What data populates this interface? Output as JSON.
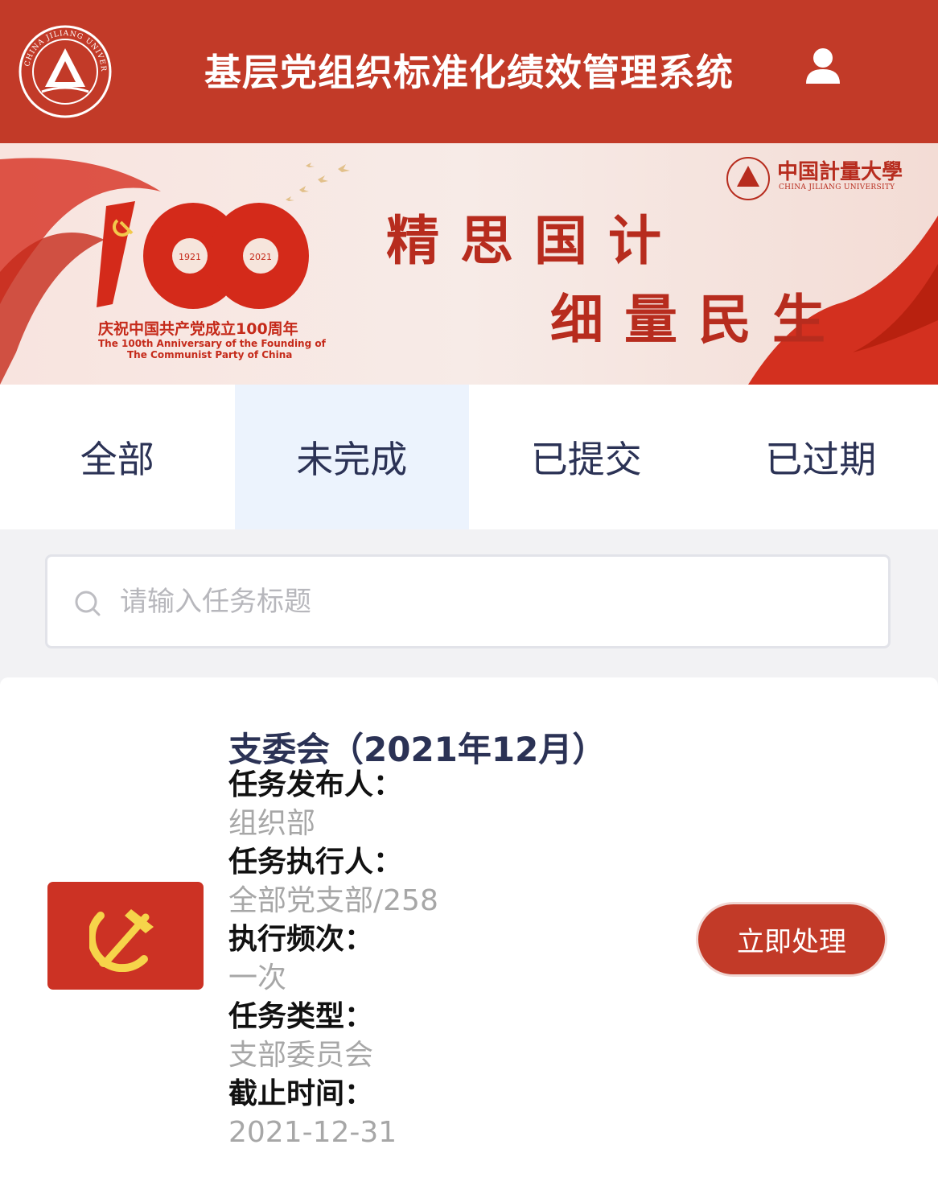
{
  "header": {
    "title": "基层党组织标准化绩效管理系统",
    "logo_icon": "university-seal-icon",
    "logo_text": "CHINA JILIANG UNIVERSITY",
    "user_icon": "user-icon",
    "color": "#c23a28"
  },
  "banner": {
    "slogan_line1": "精思国计",
    "slogan_line2": "细量民生",
    "badge_number": "100",
    "badge_year_start": "1921",
    "badge_year_end": "2021",
    "caption_cn": "庆祝中国共产党成立100周年",
    "caption_en_line1": "The 100th Anniversary of the Founding of",
    "caption_en_line2": "The Communist Party of China",
    "university_cn": "中国計量大學",
    "university_en": "CHINA JILIANG UNIVERSITY"
  },
  "tabs": [
    {
      "label": "全部",
      "active": false
    },
    {
      "label": "未完成",
      "active": true
    },
    {
      "label": "已提交",
      "active": false
    },
    {
      "label": "已过期",
      "active": false
    }
  ],
  "search": {
    "placeholder": "请输入任务标题",
    "value": "",
    "icon": "search-icon"
  },
  "task": {
    "title": "支委会（2021年12月）",
    "icon": "party-flag-icon",
    "fields": [
      {
        "label": "任务发布人：",
        "value": "组织部"
      },
      {
        "label": "任务执行人：",
        "value": "全部党支部/258"
      },
      {
        "label": "执行频次：",
        "value": "一次"
      },
      {
        "label": "任务类型：",
        "value": "支部委员会"
      },
      {
        "label": "截止时间：",
        "value": "2021-12-31"
      }
    ],
    "action_label": "立即处理"
  }
}
